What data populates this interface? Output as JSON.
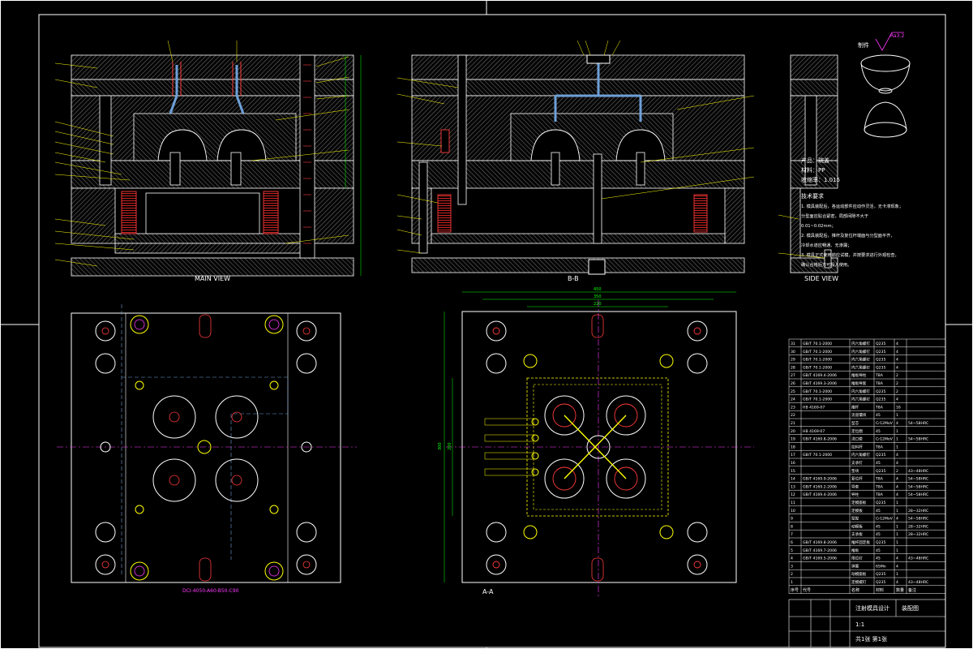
{
  "view_captions": {
    "main": "MAIN VIEW",
    "section_b": "B-B",
    "side": "SIDE VIEW",
    "cavity": "A-A"
  },
  "dimensions": {
    "width_overall": "450",
    "width_inner": "350",
    "width_core": "220",
    "height_overall": "300",
    "height_core": "200"
  },
  "mold_base_spec": "DCI-4050-A60-B50-C90",
  "product": {
    "title": "制件",
    "roughness": "Ra3.2",
    "name": "产品：碗盖",
    "material": "材料：PP",
    "shrinkage": "收缩率：1.015"
  },
  "tech_requirements": {
    "title": "技术要求",
    "lines": [
      "1. 模具装配后，各运动部件应动作灵活，无卡滞现象；",
      "    分型面应贴合紧密，局部间隙不大于",
      "    0.01~0.02mm；",
      "2. 模具装配后，推杆及复位杆端面与分型面平齐，",
      "    冷却水道应畅通、无渗漏；",
      "3. 模具正式使用前应试模，并按要求进行外观检查，",
      "    确认合格后方可投入使用。"
    ]
  },
  "parts": [
    [
      "31",
      "GB/T 70.1-2000",
      "内六角螺钉",
      "Q235",
      "4",
      ""
    ],
    [
      "30",
      "GB/T 70.1-2000",
      "内六角螺钉",
      "Q235",
      "4",
      ""
    ],
    [
      "29",
      "GB/T 70.1-2000",
      "内六角螺钉",
      "Q235",
      "4",
      ""
    ],
    [
      "28",
      "GB/T 70.1-2000",
      "内六角螺钉",
      "Q235",
      "4",
      ""
    ],
    [
      "27",
      "GB/T 4169.4-2006",
      "推板导柱",
      "T8A",
      "2",
      ""
    ],
    [
      "26",
      "GB/T 4169.3-2006",
      "推板导套",
      "T8A",
      "2",
      ""
    ],
    [
      "25",
      "GB/T 70.1-2000",
      "内六角螺钉",
      "Q235",
      "2",
      ""
    ],
    [
      "24",
      "GB/T 70.1-2000",
      "内六角螺钉",
      "Q235",
      "4",
      ""
    ],
    [
      "23",
      "HB 4169-07",
      "推杆",
      "T8A",
      "16",
      ""
    ],
    [
      "22",
      "",
      "流道镶块",
      "45",
      "1",
      ""
    ],
    [
      "21",
      "",
      "型芯",
      "Cr12MoV",
      "4",
      "54~58HRC"
    ],
    [
      "20",
      "HB 4169-07",
      "定位圈",
      "45",
      "1",
      ""
    ],
    [
      "19",
      "GB/T 4169.8-2006",
      "浇口套",
      "Cr12MoV",
      "1",
      "54~58HRC"
    ],
    [
      "18",
      "",
      "拉料杆",
      "T8A",
      "1",
      ""
    ],
    [
      "17",
      "GB/T 70.1-2000",
      "内六角螺钉",
      "Q235",
      "4",
      ""
    ],
    [
      "16",
      "",
      "支承钉",
      "45",
      "4",
      ""
    ],
    [
      "15",
      "",
      "垫块",
      "Q235",
      "2",
      "43~48HRC"
    ],
    [
      "14",
      "GB/T 4169.9-2006",
      "复位杆",
      "T8A",
      "4",
      "54~58HRC"
    ],
    [
      "13",
      "GB/T 4169.2-2006",
      "导套",
      "T8A",
      "4",
      "54~58HRC"
    ],
    [
      "12",
      "GB/T 4169.4-2006",
      "导柱",
      "T8A",
      "4",
      "54~58HRC"
    ],
    [
      "11",
      "",
      "定模座板",
      "Q235",
      "1",
      ""
    ],
    [
      "10",
      "",
      "定模板",
      "45",
      "1",
      "28~32HRC"
    ],
    [
      "9",
      "",
      "型腔",
      "Cr12MoV",
      "4",
      "54~58HRC"
    ],
    [
      "8",
      "",
      "动模板",
      "45",
      "1",
      "28~32HRC"
    ],
    [
      "7",
      "",
      "支承板",
      "45",
      "1",
      "28~32HRC"
    ],
    [
      "6",
      "GB/T 4169.8-2006",
      "推杆固定板",
      "Q235",
      "1",
      ""
    ],
    [
      "5",
      "GB/T 4169.7-2006",
      "推板",
      "45",
      "1",
      ""
    ],
    [
      "4",
      "GB/T 4169.5-2006",
      "限位钉",
      "45",
      "4",
      "43~48HRC"
    ],
    [
      "3",
      "",
      "弹簧",
      "65Mn",
      "4",
      ""
    ],
    [
      "2",
      "",
      "动模座板",
      "Q235",
      "1",
      ""
    ],
    [
      "1",
      "",
      "定模螺钉",
      "Q235",
      "4",
      "43~48HRC"
    ]
  ],
  "title_block": {
    "drawing_title": "注射模具设计",
    "drawing_number": "装配图",
    "scale": "1:1",
    "sheet": "共1张 第1张",
    "header": [
      "序号",
      "代号",
      "名称",
      "材料",
      "数量",
      "备注"
    ]
  }
}
